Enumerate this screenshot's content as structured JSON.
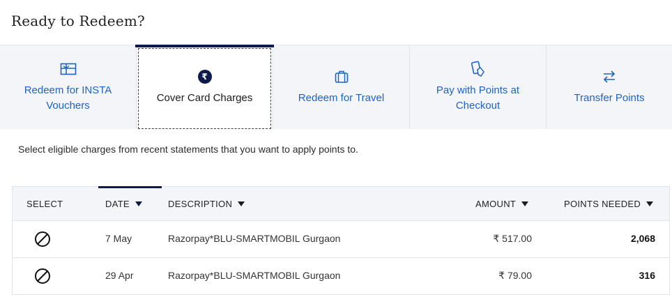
{
  "page_title": "Ready to Redeem?",
  "tabs": [
    {
      "label": "Redeem for INSTA Vouchers",
      "icon": "gift-card-icon",
      "active": false
    },
    {
      "label": "Cover Card Charges",
      "icon": "rupee-circle-icon",
      "active": true
    },
    {
      "label": "Redeem for Travel",
      "icon": "luggage-icon",
      "active": false
    },
    {
      "label": "Pay with Points at Checkout",
      "icon": "tap-to-pay-icon",
      "active": false
    },
    {
      "label": "Transfer Points",
      "icon": "transfer-arrows-icon",
      "active": false
    }
  ],
  "rupee_symbol": "₹",
  "instructions": "Select eligible charges from recent statements that you want to apply points to.",
  "table": {
    "headers": {
      "select": "SELECT",
      "date": "DATE",
      "description": "DESCRIPTION",
      "amount": "AMOUNT",
      "points_needed": "POINTS NEEDED"
    },
    "sorted_by": "date",
    "rows": [
      {
        "date": "7 May",
        "description": "Razorpay*BLU-SMARTMOBIL Gurgaon",
        "amount": "₹ 517.00",
        "points": "2,068",
        "select_icon": "no-entry-icon"
      },
      {
        "date": "29 Apr",
        "description": "Razorpay*BLU-SMARTMOBIL Gurgaon",
        "amount": "₹ 79.00",
        "points": "316",
        "select_icon": "no-entry-icon"
      }
    ]
  },
  "colors": {
    "accent_navy": "#0d1a4b",
    "link_blue": "#1e63c3",
    "tab_bg": "#f3f5f8"
  }
}
